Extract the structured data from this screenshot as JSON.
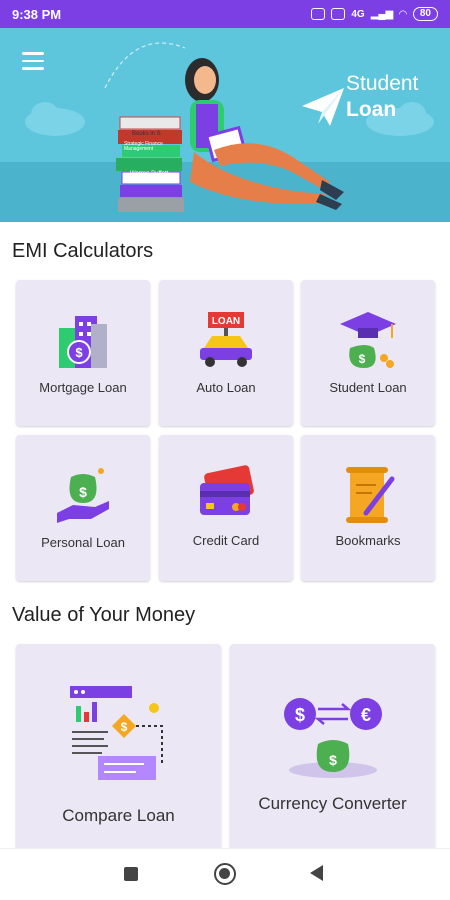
{
  "status_bar": {
    "time": "9:38 PM",
    "network_label": "4G",
    "battery": "80"
  },
  "header": {
    "brand_line1": "Student",
    "brand_line2": "Loan",
    "book_titles": [
      "Books in S",
      "Strategic Finance Management",
      "Warren Buffett"
    ]
  },
  "emi_section": {
    "title": "EMI Calculators",
    "items": [
      {
        "label": "Mortgage Loan",
        "icon": "mortgage-building-icon"
      },
      {
        "label": "Auto Loan",
        "icon": "car-loan-icon"
      },
      {
        "label": "Student Loan",
        "icon": "graduation-money-bag-icon"
      },
      {
        "label": "Personal Loan",
        "icon": "hand-money-bag-icon"
      },
      {
        "label": "Credit Card",
        "icon": "credit-card-icon"
      },
      {
        "label": "Bookmarks",
        "icon": "scroll-pen-icon"
      }
    ],
    "car_sign": "LOAN"
  },
  "value_section": {
    "title": "Value of Your Money",
    "items": [
      {
        "label": "Compare Loan",
        "icon": "compare-chart-icon"
      },
      {
        "label": "Currency Converter",
        "icon": "currency-exchange-icon"
      }
    ]
  },
  "colors": {
    "status_bar": "#7b3fe4",
    "hero_bg": "#5ec6dc",
    "card_bg": "#ece7f4",
    "accent_purple": "#7b3fe4",
    "accent_green": "#4caf50",
    "accent_orange": "#f5a623"
  }
}
